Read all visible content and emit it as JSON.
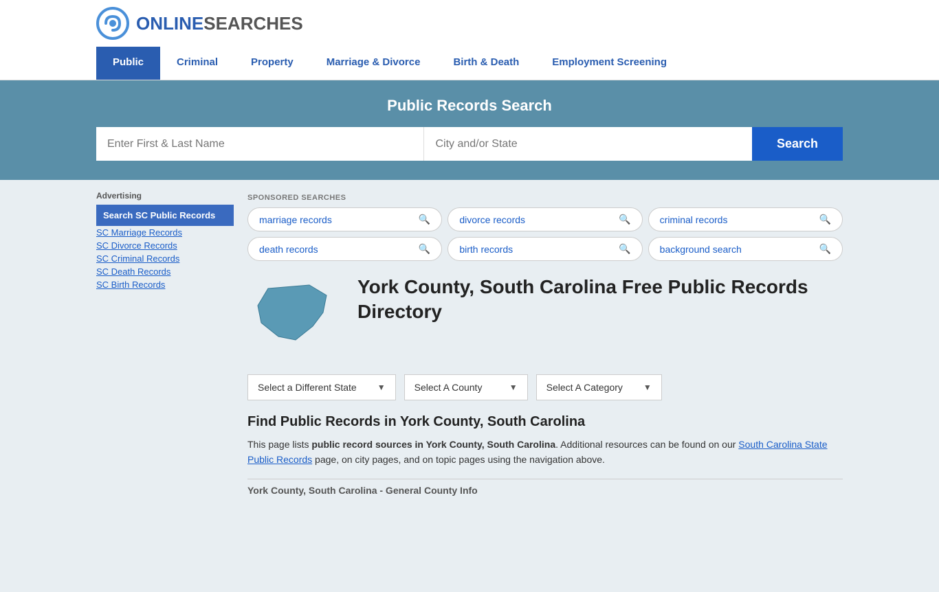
{
  "logo": {
    "online": "ONLINE",
    "searches": "SEARCHES"
  },
  "nav": {
    "items": [
      {
        "label": "Public",
        "active": true
      },
      {
        "label": "Criminal",
        "active": false
      },
      {
        "label": "Property",
        "active": false
      },
      {
        "label": "Marriage & Divorce",
        "active": false
      },
      {
        "label": "Birth & Death",
        "active": false
      },
      {
        "label": "Employment Screening",
        "active": false
      }
    ]
  },
  "hero": {
    "title": "Public Records Search",
    "name_placeholder": "Enter First & Last Name",
    "location_placeholder": "City and/or State",
    "search_btn": "Search"
  },
  "sponsored": {
    "label": "SPONSORED SEARCHES",
    "tags": [
      {
        "label": "marriage records"
      },
      {
        "label": "divorce records"
      },
      {
        "label": "criminal records"
      },
      {
        "label": "death records"
      },
      {
        "label": "birth records"
      },
      {
        "label": "background search"
      }
    ]
  },
  "directory": {
    "title": "York County, South Carolina Free Public Records Directory"
  },
  "selectors": {
    "state": "Select a Different State",
    "county": "Select A County",
    "category": "Select A Category"
  },
  "find": {
    "title": "Find Public Records in York County, South Carolina",
    "text_before": "This page lists ",
    "text_bold": "public record sources in York County, South Carolina",
    "text_middle": ". Additional resources can be found on our ",
    "link": "South Carolina State Public Records",
    "text_after": " page, on city pages, and on topic pages using the navigation above."
  },
  "footer_section": {
    "label": "York County, South Carolina - General County Info"
  },
  "sidebar": {
    "ad_label": "Advertising",
    "ad_item": "Search SC Public Records",
    "links": [
      "SC Marriage Records",
      "SC Divorce Records",
      "SC Criminal Records",
      "SC Death Records",
      "SC Birth Records"
    ]
  }
}
